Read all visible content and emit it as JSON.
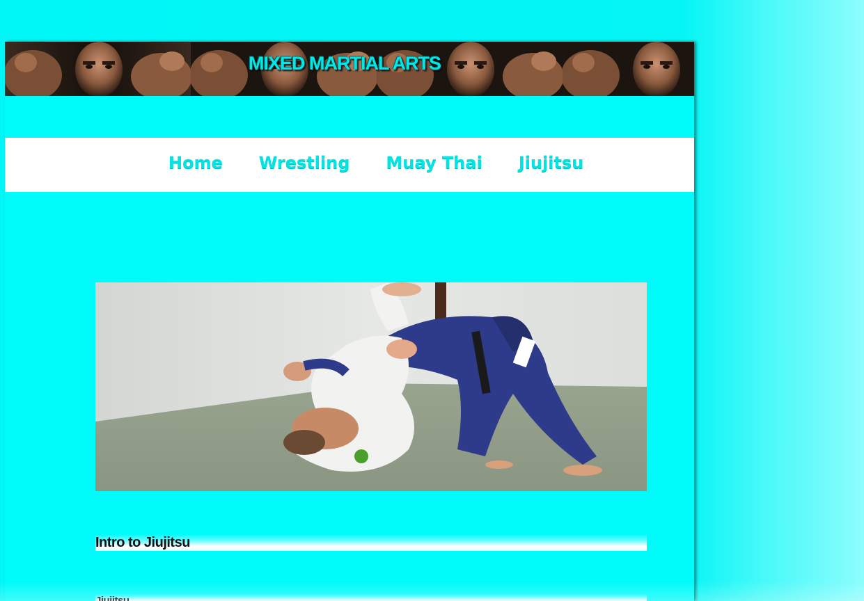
{
  "banner": {
    "title": "MIXED MARTIAL ARTS",
    "image": "fighter-portrait-collage"
  },
  "nav": {
    "items": [
      {
        "label": "Home"
      },
      {
        "label": "Wrestling"
      },
      {
        "label": "Muay Thai"
      },
      {
        "label": "Jiujitsu"
      }
    ]
  },
  "hero": {
    "image": "jiujitsu-grappling-photo"
  },
  "sections": [
    {
      "title": "Intro to Jiujitsu"
    },
    {
      "title": "Jiujitsu"
    }
  ],
  "colors": {
    "page_background": "#00fbfb",
    "nav_text": "#00e4e4",
    "banner_title": "#00e8e8",
    "navbar_background": "#ffffff"
  }
}
